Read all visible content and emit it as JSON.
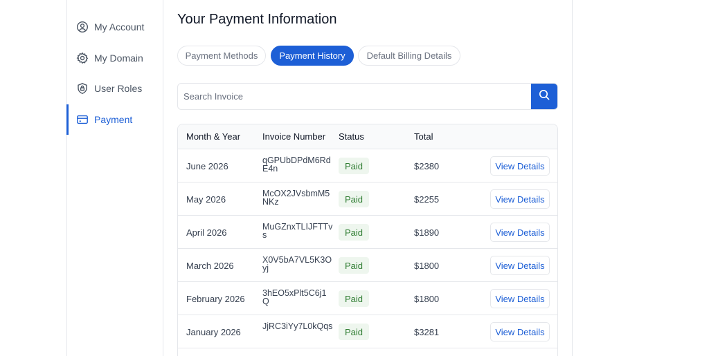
{
  "sidebar": {
    "items": [
      {
        "label": "My Account",
        "icon": "user-circle-icon",
        "active": false
      },
      {
        "label": "My Domain",
        "icon": "gear-icon",
        "active": false
      },
      {
        "label": "User Roles",
        "icon": "shield-icon",
        "active": false
      },
      {
        "label": "Payment",
        "icon": "credit-card-icon",
        "active": true
      }
    ]
  },
  "page": {
    "title": "Your Payment Information"
  },
  "tabs": [
    {
      "label": "Payment Methods",
      "active": false
    },
    {
      "label": "Payment History",
      "active": true
    },
    {
      "label": "Default Billing Details",
      "active": false
    }
  ],
  "search": {
    "placeholder": "Search Invoice",
    "value": ""
  },
  "table": {
    "headers": {
      "month": "Month & Year",
      "invoice": "Invoice Number",
      "status": "Status",
      "total": "Total"
    },
    "rows": [
      {
        "month": "June 2026",
        "invoice": "qGPUbDPdM6RdE4n",
        "status": "Paid",
        "total": "$2380",
        "action": "View Details"
      },
      {
        "month": "May 2026",
        "invoice": "McOX2JVsbmM5NKz",
        "status": "Paid",
        "total": "$2255",
        "action": "View Details"
      },
      {
        "month": "April 2026",
        "invoice": "MuGZnxTLIJFTTvs",
        "status": "Paid",
        "total": "$1890",
        "action": "View Details"
      },
      {
        "month": "March 2026",
        "invoice": "X0V5bA7VL5K3Oyj",
        "status": "Paid",
        "total": "$1800",
        "action": "View Details"
      },
      {
        "month": "February 2026",
        "invoice": "3hEO5xPlt5C6j1Q",
        "status": "Paid",
        "total": "$1800",
        "action": "View Details"
      },
      {
        "month": "January 2026",
        "invoice": "JjRC3iYy7L0kQqs",
        "status": "Paid",
        "total": "$3281",
        "action": "View Details"
      }
    ]
  },
  "colors": {
    "accent": "#1d5fd6",
    "paid_bg": "#eef6ee",
    "paid_text": "#2f7d32",
    "border": "#e5e7eb"
  }
}
